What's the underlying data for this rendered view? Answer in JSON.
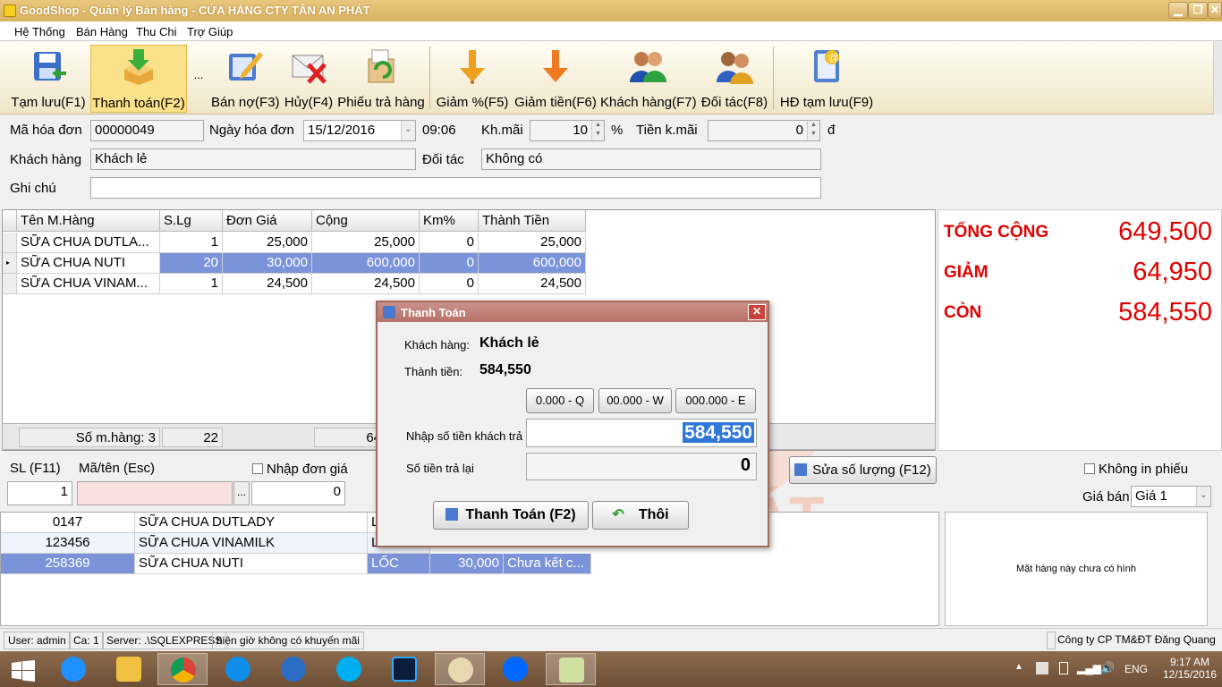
{
  "window": {
    "title": "GoodShop - Quản lý Bán hàng - CỬA HÀNG CTY TÂN AN PHÁT",
    "min": "▁",
    "max": "❐",
    "close": "✕"
  },
  "menu": [
    "Hệ Thống",
    "Bán Hàng",
    "Thu Chi",
    "Trợ Giúp"
  ],
  "toolbar": {
    "items": [
      {
        "label": "Tạm lưu(F1)",
        "icon": "save-icon"
      },
      {
        "label": "Thanh toán(F2)",
        "icon": "checkout-icon"
      },
      {
        "label": "Bán nợ(F3)",
        "icon": "edit-icon"
      },
      {
        "label": "Hủy(F4)",
        "icon": "cancel-mail-icon"
      },
      {
        "label": "Phiếu trả hàng",
        "icon": "return-icon"
      },
      {
        "label": "Giảm %(F5)",
        "icon": "discount-percent-icon"
      },
      {
        "label": "Giảm tiền(F6)",
        "icon": "discount-money-icon"
      },
      {
        "label": "Khách hàng(F7)",
        "icon": "customers-icon"
      },
      {
        "label": "Đối tác(F8)",
        "icon": "partners-icon"
      },
      {
        "label": "HĐ tạm lưu(F9)",
        "icon": "saved-invoice-icon"
      }
    ],
    "more": "..."
  },
  "invoice": {
    "ma_hd_label": "Mã hóa đơn",
    "ma_hd": "00000049",
    "ngay_label": "Ngày hóa đơn",
    "ngay": "15/12/2016",
    "gio": "09:06",
    "kmai_label": "Kh.mãi",
    "kmai": "10",
    "pct": "%",
    "tien_kmai_label": "Tiền k.mãi",
    "tien_kmai": "0",
    "dong": "đ",
    "khach_label": "Khách hàng",
    "khach": "Khách lẻ",
    "doitac_label": "Đối tác",
    "doitac": "Không có",
    "ghichu_label": "Ghi chú",
    "ghichu": ""
  },
  "grid": {
    "headers": [
      "Tên M.Hàng",
      "S.Lg",
      "Đơn Giá",
      "Cộng",
      "Km%",
      "Thành Tiền"
    ],
    "rows": [
      [
        "SỮA CHUA DUTLA...",
        "1",
        "25,000",
        "25,000",
        "0",
        "25,000"
      ],
      [
        "SỮA CHUA NUTI",
        "20",
        "30,000",
        "600,000",
        "0",
        "600,000"
      ],
      [
        "SỮA CHUA VINAM...",
        "1",
        "24,500",
        "24,500",
        "0",
        "24,500"
      ]
    ],
    "footer": {
      "count": "Số m.hàng: 3",
      "qty": "22",
      "sum": "64"
    }
  },
  "totals": {
    "tong_label": "TỔNG CỘNG",
    "tong": "649,500",
    "giam_label": "GIẢM",
    "giam": "64,950",
    "con_label": "CÒN",
    "con": "584,550"
  },
  "entry": {
    "sl_label": "SL (F11)",
    "ma_label": "Mã/tên (Esc)",
    "nhap_dg": "Nhập đơn giá",
    "sl": "1",
    "ma": "",
    "browse": "...",
    "dongia": "0",
    "sua_sl": "Sửa số lượng (F12)",
    "khong_in": "Không in phiếu",
    "gia_ban_label": "Giá bán",
    "gia_ban": "Giá 1"
  },
  "list": {
    "rows": [
      [
        "0147",
        "SỮA CHUA DUTLADY",
        "L",
        "",
        ""
      ],
      [
        "123456",
        "SỮA CHUA VINAMILK",
        "L",
        "",
        ""
      ],
      [
        "258369",
        "SỮA CHUA NUTI",
        "LỐC",
        "30,000",
        "Chưa kết c..."
      ]
    ]
  },
  "no_image": "Mặt hàng này chưa có hình",
  "watermark": "TÂN AN PHÁT",
  "dialog": {
    "title": "Thanh Toán",
    "close": "✕",
    "khach_label": "Khách hàng:",
    "khach": "Khách lẻ",
    "thanh_tien_label": "Thành tiền:",
    "thanh_tien": "584,550",
    "quick": [
      "0.000 - Q",
      "00.000 - W",
      "000.000 - E"
    ],
    "nhap_label": "Nhập số tiền khách trả",
    "nhap": "584,550",
    "tra_lai_label": "Số tiền trả lại",
    "tra_lai": "0",
    "ok": "Thanh Toán (F2)",
    "cancel": "Thôi"
  },
  "status": {
    "user": "User: admin",
    "ca": "Ca: 1",
    "server": "Server: .\\SQLEXPRESS",
    "km": "hiện giờ không có khuyến mãi",
    "company": "Công ty CP TM&ĐT Đăng Quang"
  },
  "taskbar": {
    "apps": [
      "windows-start-icon",
      "internet-explorer-icon",
      "file-explorer-icon",
      "chrome-icon",
      "teamviewer-icon",
      "remote-desktop-icon",
      "skype-icon",
      "photoshop-icon",
      "paint-icon",
      "zalo-icon",
      "goodshop-icon"
    ],
    "lang": "ENG",
    "time": "9:17 AM",
    "date": "12/15/2016"
  }
}
